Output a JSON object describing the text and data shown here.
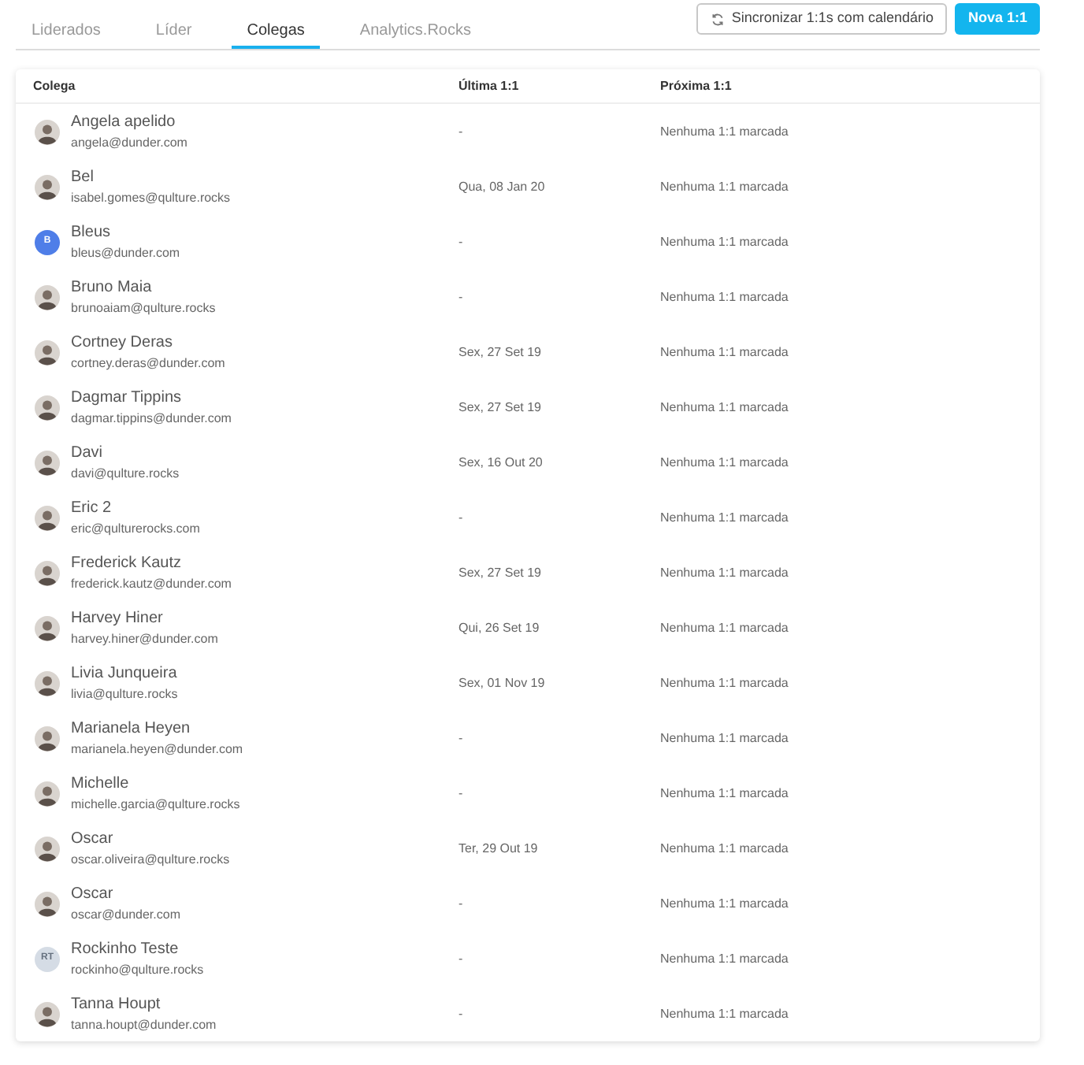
{
  "tabs": [
    {
      "label": "Liderados",
      "selected": false
    },
    {
      "label": "Líder",
      "selected": false
    },
    {
      "label": "Colegas",
      "selected": true
    },
    {
      "label": "Analytics.Rocks",
      "selected": false
    }
  ],
  "actions": {
    "sync_button": "Sincronizar 1:1s com calendário",
    "new_button": "Nova 1:1"
  },
  "table": {
    "columns": [
      "Colega",
      "Última 1:1",
      "Próxima 1:1"
    ],
    "rows": [
      {
        "name": "Angela apelido",
        "email": "angela@dunder.com",
        "last": "-",
        "next": "Nenhuma 1:1 marcada",
        "avatar": {
          "kind": "photo"
        }
      },
      {
        "name": "Bel",
        "email": "isabel.gomes@qulture.rocks",
        "last": "Qua, 08 Jan 20",
        "next": "Nenhuma 1:1 marcada",
        "avatar": {
          "kind": "photo"
        }
      },
      {
        "name": "Bleus",
        "email": "bleus@dunder.com",
        "last": "-",
        "next": "Nenhuma 1:1 marcada",
        "avatar": {
          "kind": "initials",
          "initials": "B",
          "color": "#4f7ee8"
        }
      },
      {
        "name": "Bruno Maia",
        "email": "brunoaiam@qulture.rocks",
        "last": "-",
        "next": "Nenhuma 1:1 marcada",
        "avatar": {
          "kind": "photo"
        }
      },
      {
        "name": "Cortney Deras",
        "email": "cortney.deras@dunder.com",
        "last": "Sex, 27 Set 19",
        "next": "Nenhuma 1:1 marcada",
        "avatar": {
          "kind": "photo"
        }
      },
      {
        "name": "Dagmar Tippins",
        "email": "dagmar.tippins@dunder.com",
        "last": "Sex, 27 Set 19",
        "next": "Nenhuma 1:1 marcada",
        "avatar": {
          "kind": "photo"
        }
      },
      {
        "name": "Davi",
        "email": "davi@qulture.rocks",
        "last": "Sex, 16 Out 20",
        "next": "Nenhuma 1:1 marcada",
        "avatar": {
          "kind": "photo"
        }
      },
      {
        "name": "Eric 2",
        "email": "eric@qulturerocks.com",
        "last": "-",
        "next": "Nenhuma 1:1 marcada",
        "avatar": {
          "kind": "photo"
        }
      },
      {
        "name": "Frederick Kautz",
        "email": "frederick.kautz@dunder.com",
        "last": "Sex, 27 Set 19",
        "next": "Nenhuma 1:1 marcada",
        "avatar": {
          "kind": "photo"
        }
      },
      {
        "name": "Harvey Hiner",
        "email": "harvey.hiner@dunder.com",
        "last": "Qui, 26 Set 19",
        "next": "Nenhuma 1:1 marcada",
        "avatar": {
          "kind": "photo"
        }
      },
      {
        "name": "Livia Junqueira",
        "email": "livia@qulture.rocks",
        "last": "Sex, 01 Nov 19",
        "next": "Nenhuma 1:1 marcada",
        "avatar": {
          "kind": "photo"
        }
      },
      {
        "name": "Marianela Heyen",
        "email": "marianela.heyen@dunder.com",
        "last": "-",
        "next": "Nenhuma 1:1 marcada",
        "avatar": {
          "kind": "photo"
        }
      },
      {
        "name": "Michelle",
        "email": "michelle.garcia@qulture.rocks",
        "last": "-",
        "next": "Nenhuma 1:1 marcada",
        "avatar": {
          "kind": "photo"
        }
      },
      {
        "name": "Oscar",
        "email": "oscar.oliveira@qulture.rocks",
        "last": "Ter, 29 Out 19",
        "next": "Nenhuma 1:1 marcada",
        "avatar": {
          "kind": "photo"
        }
      },
      {
        "name": "Oscar",
        "email": "oscar@dunder.com",
        "last": "-",
        "next": "Nenhuma 1:1 marcada",
        "avatar": {
          "kind": "photo"
        }
      },
      {
        "name": "Rockinho Teste",
        "email": "rockinho@qulture.rocks",
        "last": "-",
        "next": "Nenhuma 1:1 marcada",
        "avatar": {
          "kind": "initials",
          "initials": "RT",
          "color": "#d5dce5"
        }
      },
      {
        "name": "Tanna Houpt",
        "email": "tanna.houpt@dunder.com",
        "last": "-",
        "next": "Nenhuma 1:1 marcada",
        "avatar": {
          "kind": "photo"
        }
      }
    ]
  }
}
